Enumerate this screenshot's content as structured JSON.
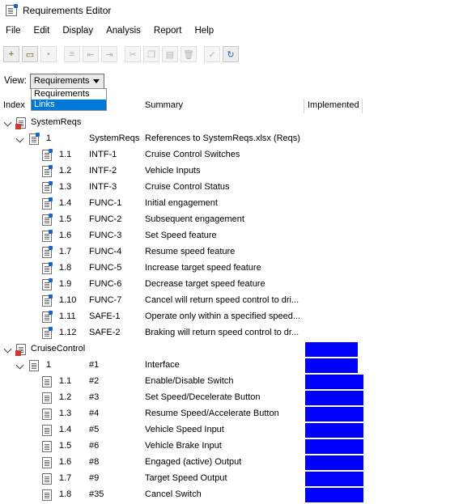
{
  "window": {
    "title": "Requirements Editor"
  },
  "menu": [
    "File",
    "Edit",
    "Display",
    "Analysis",
    "Report",
    "Help"
  ],
  "toolbar": {
    "buttons": [
      {
        "name": "new-set-icon",
        "enabled": true
      },
      {
        "name": "open-folder-icon",
        "enabled": true
      },
      {
        "name": "save-icon",
        "enabled": false
      },
      {
        "name": "add-requirement-icon",
        "enabled": false
      },
      {
        "name": "add-child-icon",
        "enabled": false
      },
      {
        "name": "add-justification-icon",
        "enabled": false
      },
      {
        "name": "cut-icon",
        "enabled": false
      },
      {
        "name": "copy-icon",
        "enabled": false
      },
      {
        "name": "paste-icon",
        "enabled": false
      },
      {
        "name": "delete-icon",
        "enabled": false
      },
      {
        "name": "check-icon",
        "enabled": false
      },
      {
        "name": "refresh-icon",
        "enabled": true
      }
    ]
  },
  "view": {
    "label": "View:",
    "selected": "Requirements",
    "options": [
      "Requirements",
      "Links"
    ],
    "highlighted_option": "Links"
  },
  "columns": {
    "index": "Index",
    "summary": "Summary",
    "implemented": "Implemented"
  },
  "colors": {
    "implemented_bar": "#0000ff",
    "selection": "#0078d7"
  },
  "sets": [
    {
      "name": "SystemReqs",
      "rows": [
        {
          "index": "1",
          "id": "SystemReqs",
          "summary": "References to SystemReqs.xlsx (Reqs)",
          "level": 1,
          "expanded": true,
          "implemented": null
        },
        {
          "index": "1.1",
          "id": "INTF-1",
          "summary": "Cruise Control Switches",
          "level": 2,
          "implemented": null
        },
        {
          "index": "1.2",
          "id": "INTF-2",
          "summary": "Vehicle Inputs",
          "level": 2,
          "implemented": null
        },
        {
          "index": "1.3",
          "id": "INTF-3",
          "summary": "Cruise Control Status",
          "level": 2,
          "implemented": null
        },
        {
          "index": "1.4",
          "id": "FUNC-1",
          "summary": "Initial engagement",
          "level": 2,
          "implemented": null
        },
        {
          "index": "1.5",
          "id": "FUNC-2",
          "summary": "Subsequent engagement",
          "level": 2,
          "implemented": null
        },
        {
          "index": "1.6",
          "id": "FUNC-3",
          "summary": "Set Speed feature",
          "level": 2,
          "implemented": null
        },
        {
          "index": "1.7",
          "id": "FUNC-4",
          "summary": "Resume speed feature",
          "level": 2,
          "implemented": null
        },
        {
          "index": "1.8",
          "id": "FUNC-5",
          "summary": "Increase target speed feature",
          "level": 2,
          "implemented": null
        },
        {
          "index": "1.9",
          "id": "FUNC-6",
          "summary": "Decrease target speed feature",
          "level": 2,
          "implemented": null
        },
        {
          "index": "1.10",
          "id": "FUNC-7",
          "summary": "Cancel will return speed control to dri...",
          "level": 2,
          "implemented": null
        },
        {
          "index": "1.11",
          "id": "SAFE-1",
          "summary": "Operate only within a specified speed...",
          "level": 2,
          "implemented": null
        },
        {
          "index": "1.12",
          "id": "SAFE-2",
          "summary": "Braking will return speed control to dr...",
          "level": 2,
          "implemented": null
        }
      ]
    },
    {
      "name": "CruiseControl",
      "implemented": 0.9,
      "rows": [
        {
          "index": "1",
          "id": "#1",
          "summary": "Interface",
          "level": 1,
          "expanded": true,
          "implemented": 0.9
        },
        {
          "index": "1.1",
          "id": "#2",
          "summary": "Enable/Disable Switch",
          "level": 2,
          "implemented": 1.0
        },
        {
          "index": "1.2",
          "id": "#3",
          "summary": "Set Speed/Decelerate Button",
          "level": 2,
          "implemented": 1.0
        },
        {
          "index": "1.3",
          "id": "#4",
          "summary": "Resume Speed/Accelerate Button",
          "level": 2,
          "implemented": 1.0
        },
        {
          "index": "1.4",
          "id": "#5",
          "summary": "Vehicle Speed Input",
          "level": 2,
          "implemented": 1.0
        },
        {
          "index": "1.5",
          "id": "#6",
          "summary": "Vehicle Brake Input",
          "level": 2,
          "implemented": 1.0
        },
        {
          "index": "1.6",
          "id": "#8",
          "summary": "Engaged (active) Output",
          "level": 2,
          "implemented": 1.0
        },
        {
          "index": "1.7",
          "id": "#9",
          "summary": "Target Speed Output",
          "level": 2,
          "implemented": 1.0
        },
        {
          "index": "1.8",
          "id": "#35",
          "summary": "Cancel Switch",
          "level": 2,
          "implemented": 1.0
        }
      ]
    }
  ]
}
